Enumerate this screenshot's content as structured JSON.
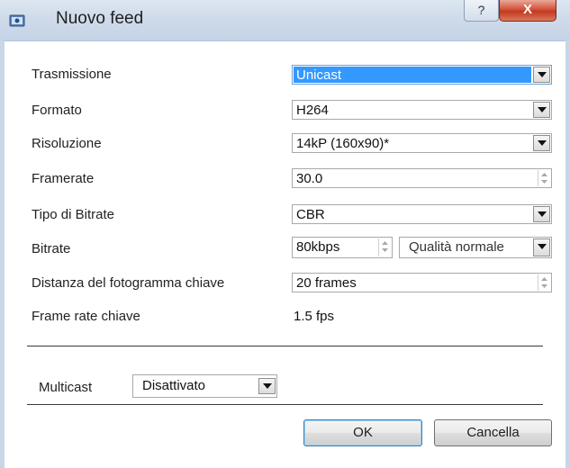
{
  "window": {
    "title": "Nuovo feed",
    "help_label": "?",
    "close_label": "X"
  },
  "form": {
    "trasmissione": {
      "label": "Trasmissione",
      "value": "Unicast"
    },
    "formato": {
      "label": "Formato",
      "value": "H264"
    },
    "risoluzione": {
      "label": "Risoluzione",
      "value": "14kP (160x90)*"
    },
    "framerate": {
      "label": "Framerate",
      "value": "30.0"
    },
    "tipo_bitrate": {
      "label": "Tipo di Bitrate",
      "value": "CBR"
    },
    "bitrate": {
      "label": "Bitrate",
      "value": "80kbps",
      "quality": "Qualità normale"
    },
    "distanza": {
      "label": "Distanza del fotogramma chiave",
      "value": "20 frames"
    },
    "frame_rate_chiave": {
      "label": "Frame rate chiave",
      "value": "1.5 fps"
    }
  },
  "multicast": {
    "label": "Multicast",
    "value": "Disattivato"
  },
  "buttons": {
    "ok": "OK",
    "cancel": "Cancella"
  }
}
